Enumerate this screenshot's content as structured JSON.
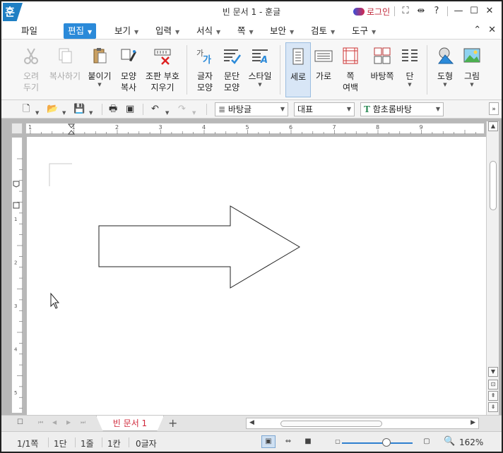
{
  "window": {
    "logo": "훈",
    "title": "빈 문서 1 - 훈글",
    "login": "로그인"
  },
  "menu": {
    "items": [
      "파일",
      "편집",
      "보기",
      "입력",
      "서식",
      "쪽",
      "보안",
      "검토",
      "도구"
    ],
    "active": "편집"
  },
  "ribbon": {
    "cut": [
      "오려",
      "두기"
    ],
    "copy": "복사하기",
    "paste": "붙이기",
    "format_copy": [
      "모양",
      "복사"
    ],
    "clear_marks": [
      "조판 부호",
      "지우기"
    ],
    "char_shape": [
      "글자",
      "모양"
    ],
    "para_shape": [
      "문단",
      "모양"
    ],
    "style": "스타일",
    "vertical": "세로",
    "horizontal": "가로",
    "page_margin": [
      "쪽",
      "여백"
    ],
    "background_page": "바탕쪽",
    "columns": "단",
    "shape": "도형",
    "picture": "그림"
  },
  "toolbar": {
    "style_combo": "바탕글",
    "language_combo": "대표",
    "font_combo": "함초롬바탕"
  },
  "ruler": {
    "h_ticks": [
      "1",
      "1",
      "2",
      "3",
      "4",
      "5",
      "6",
      "7",
      "8",
      "9"
    ],
    "v_ticks": [
      "1",
      "2",
      "3",
      "4",
      "5"
    ]
  },
  "tabs": {
    "document": "빈 문서 1",
    "add": "+"
  },
  "status": {
    "page": "1/1쪽",
    "column": "1단",
    "line": "1줄",
    "cell": "1칸",
    "chars": "0글자",
    "zoom": "162%"
  },
  "colors": {
    "accent": "#2b8ad9",
    "logo": "#1f7fc4",
    "login": "#c0283a",
    "tab_text": "#d0283a"
  },
  "icons": [
    "app-logo-icon",
    "scissors-icon",
    "copy-icon",
    "clipboard-icon",
    "brush-icon",
    "clear-marks-icon",
    "char-shape-icon",
    "para-shape-icon",
    "style-icon",
    "portrait-icon",
    "landscape-icon",
    "margin-icon",
    "background-page-icon",
    "columns-icon",
    "shape-icon",
    "picture-icon"
  ]
}
